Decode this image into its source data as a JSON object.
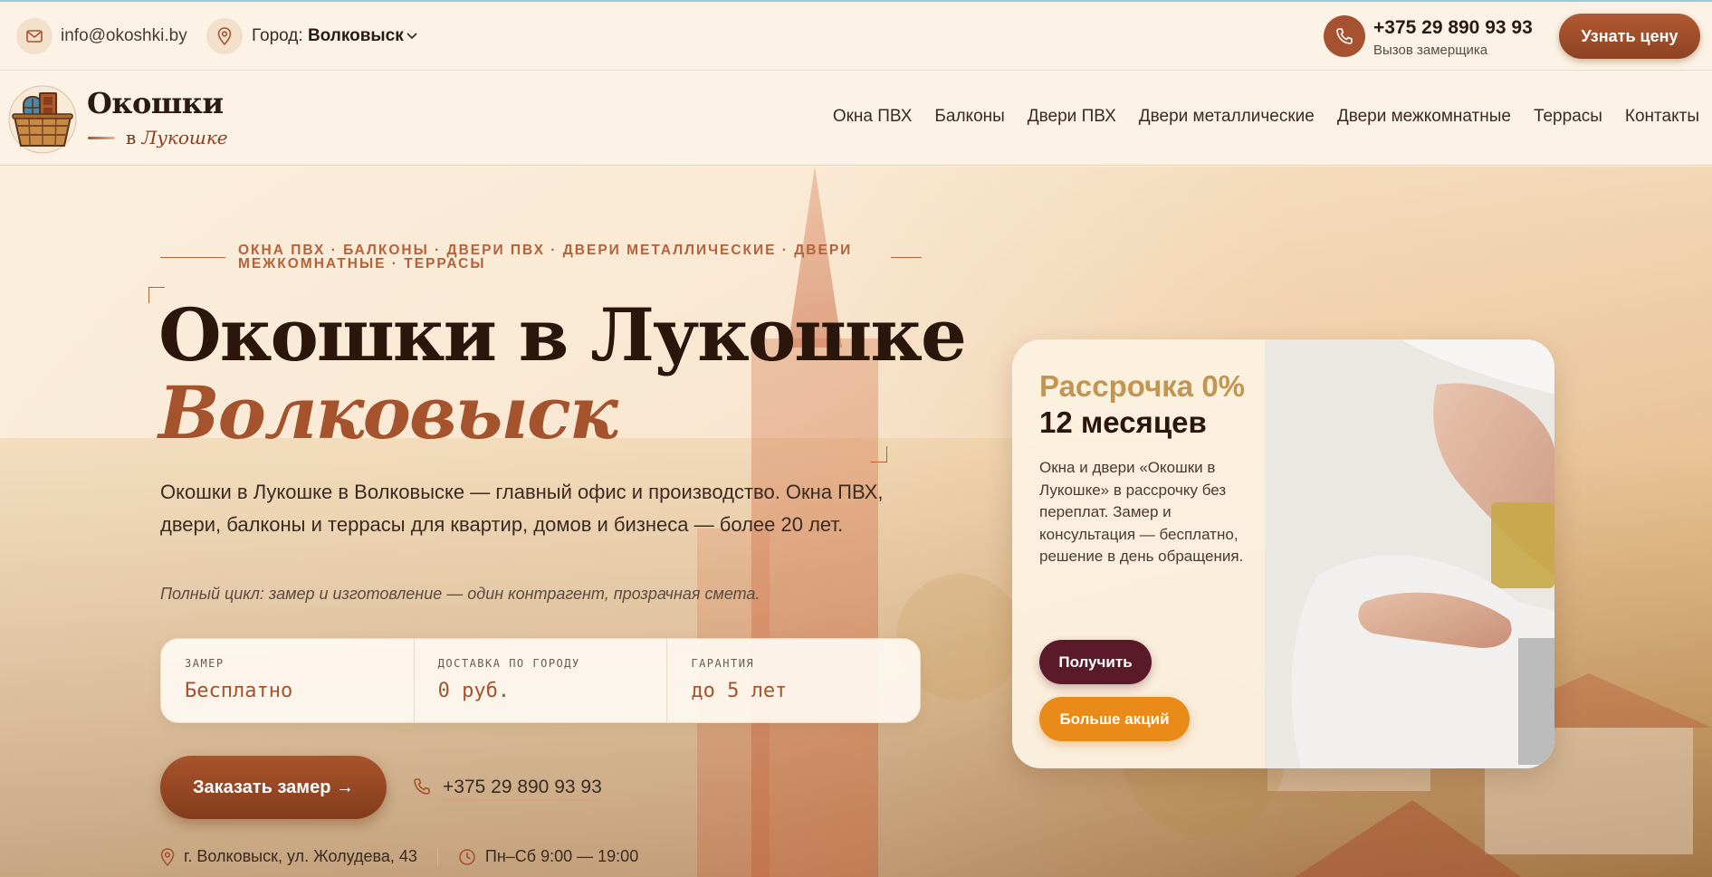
{
  "topbar": {
    "email": "info@okoshki.by",
    "city_label": "Город:",
    "city_value": "Волковыск",
    "phone": "+375 29 890 93 93",
    "phone_caption": "Вызов замерщика",
    "price_button": "Узнать цену"
  },
  "logo": {
    "title": "Окошки",
    "sub_prefix": "в",
    "sub_italic": "Лукошке"
  },
  "nav": {
    "items": [
      "Окна ПВХ",
      "Балконы",
      "Двери ПВХ",
      "Двери металлические",
      "Двери межкомнатные",
      "Террасы",
      "Контакты"
    ]
  },
  "hero": {
    "eyebrow": "Окна ПВХ · Балконы · Двери ПВХ · Двери металлические · Двери межкомнатные · Террасы",
    "title": "Окошки в Лукошке",
    "city": "Волковыск",
    "description": "Окошки в Лукошке в Волковыске — главный офис и производство. Окна ПВХ, двери, балконы и террасы для квартир, домов и бизнеса — более 20 лет.",
    "note": "Полный цикл: замер и изготовление — один контрагент, прозрачная смета.",
    "stats": [
      {
        "label": "ЗАМЕР",
        "value": "Бесплатно"
      },
      {
        "label": "ДОСТАВКА ПО ГОРОДУ",
        "value": "0 руб."
      },
      {
        "label": "ГАРАНТИЯ",
        "value": "до 5 лет"
      }
    ],
    "cta_button": "Заказать замер →",
    "cta_phone": "+375 29 890 93 93",
    "address": "г. Волковыск, ул. Жолудева, 43",
    "hours": "Пн–Сб 9:00 — 19:00"
  },
  "promo": {
    "title": "Рассрочка 0%",
    "months": "12 месяцев",
    "description": "Окна и двери «Окошки в Лукошке» в рассрочку без переплат. Замер и консультация — бесплатно, решение в день обращения.",
    "get_button": "Получить",
    "more_button": "Больше акций"
  },
  "colors": {
    "accent": "#a65230",
    "gold": "#c29550",
    "wine": "#5a1a2a",
    "orange": "#ea8a18",
    "background": "#fcf3e6"
  },
  "icons": [
    "mail-icon",
    "map-pin-icon",
    "chevron-down-icon",
    "phone-icon",
    "clock-icon",
    "basket-logo"
  ]
}
